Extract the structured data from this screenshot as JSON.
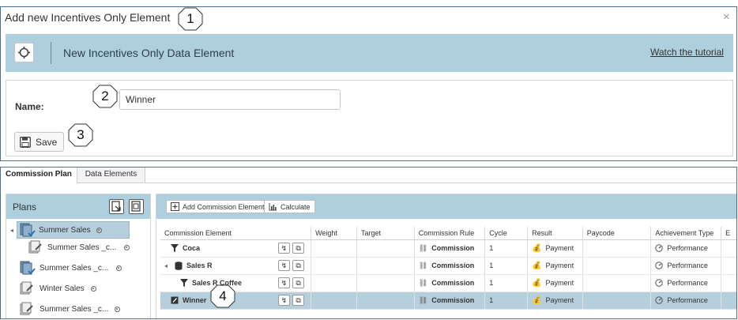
{
  "dialog": {
    "title": "Add new Incentives Only Element",
    "close_glyph": "×",
    "bar_title": "New Incentives Only Data Element",
    "tutorial_link": "Watch the tutorial",
    "name_label": "Name:",
    "name_value": "Winner",
    "save_label": "Save"
  },
  "callouts": [
    "1",
    "2",
    "3",
    "4"
  ],
  "tabs": [
    {
      "label": "Commission Plan",
      "active": true
    },
    {
      "label": "Data Elements",
      "active": false
    }
  ],
  "plans": {
    "title": "Plans",
    "items": [
      {
        "label": "Summer Sales",
        "expander": "◂",
        "icon": "plan-approved-icon",
        "selected": true
      },
      {
        "label": "Summer Sales _c...",
        "icon": "plan-edit-icon",
        "selected": false
      },
      {
        "label": "Summer Sales _c...",
        "icon": "plan-approved-icon",
        "selected": false
      },
      {
        "label": "Winter Sales",
        "icon": "plan-edit-icon",
        "selected": false
      },
      {
        "label": "Summer Sales _c...",
        "icon": "plan-edit-icon",
        "selected": false
      }
    ]
  },
  "toolbar": {
    "add_label": "Add Commission Element",
    "calculate_label": "Calculate"
  },
  "grid": {
    "columns": [
      "Commission Element",
      "Weight",
      "Target",
      "Commission Rule",
      "Cycle",
      "Result",
      "Paycode",
      "Achievement Type",
      "E"
    ],
    "rows": [
      {
        "element": "Coca",
        "icon": "filter-icon",
        "indent": 0,
        "expander": "",
        "rule": "Commission",
        "cycle": "1",
        "result": "Payment",
        "achievement": "Performance",
        "selected": false
      },
      {
        "element": "Sales R",
        "icon": "database-icon",
        "indent": 0,
        "expander": "◂",
        "rule": "Commission",
        "cycle": "1",
        "result": "Payment",
        "achievement": "Performance",
        "selected": false
      },
      {
        "element": "Sales R Coffee",
        "icon": "filter-icon",
        "indent": 1,
        "expander": "",
        "rule": "Commission",
        "cycle": "1",
        "result": "Payment",
        "achievement": "Performance",
        "selected": false
      },
      {
        "element": "Winner",
        "icon": "edit-icon",
        "indent": 0,
        "expander": "",
        "rule": "Commission",
        "cycle": "1",
        "result": "Payment",
        "achievement": "Performance",
        "selected": true
      }
    ]
  },
  "colors": {
    "accent_bar": "#aecfdd",
    "selected_row": "#b6cfdc",
    "frame_border": "#4d6f8a"
  }
}
